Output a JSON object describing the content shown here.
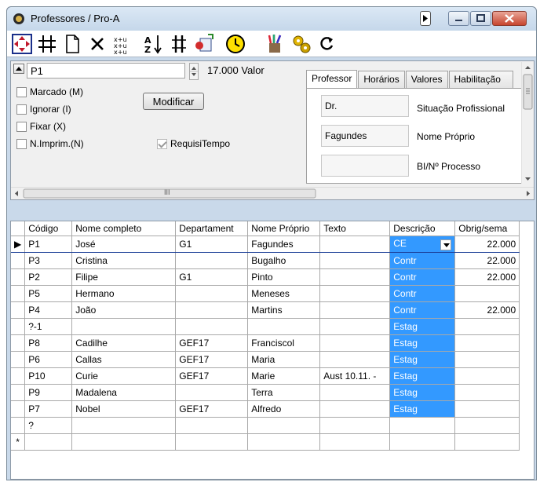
{
  "window": {
    "title": "Professores / Pro-A"
  },
  "toolbar": {
    "tools": [
      {
        "name": "navigate-icon"
      },
      {
        "name": "grid-icon"
      },
      {
        "name": "new-document-icon"
      },
      {
        "name": "delete-icon"
      },
      {
        "name": "sort-fields-icon"
      },
      {
        "name": "sort-az-icon"
      },
      {
        "name": "columns-icon"
      },
      {
        "name": "export-icon"
      },
      {
        "name": "clock-icon"
      },
      {
        "name": "paint-icon"
      },
      {
        "name": "settings-icon"
      },
      {
        "name": "refresh-icon"
      }
    ]
  },
  "form": {
    "code_value": "P1",
    "valor_label": "17.000 Valor",
    "checkboxes": [
      {
        "label": "Marcado (M)",
        "checked": false
      },
      {
        "label": "Ignorar (I)",
        "checked": false
      },
      {
        "label": "Fixar (X)",
        "checked": false
      },
      {
        "label": "N.Imprim.(N)",
        "checked": false
      }
    ],
    "requisitempo": {
      "label": "RequisiTempo",
      "checked": true
    },
    "modify_button": "Modificar",
    "tabs": [
      "Professor",
      "Horários",
      "Valores",
      "Habilitação"
    ],
    "fields": [
      {
        "value": "Dr.",
        "label": "Situação Profissional"
      },
      {
        "value": "Fagundes",
        "label": "Nome Próprio"
      },
      {
        "value": "",
        "label": "BI/Nº Processo"
      }
    ],
    "hscroll_grip": "III"
  },
  "grid": {
    "columns": [
      "Código",
      "Nome completo",
      "Departament",
      "Nome Próprio",
      "Texto",
      "Descrição",
      "Obrig/sema"
    ],
    "rows": [
      {
        "marker": "▶",
        "code": "P1",
        "name": "José",
        "dept": "G1",
        "first": "Fagundes",
        "text": "",
        "desc": "CE",
        "obrig": "22.000"
      },
      {
        "marker": "",
        "code": "P3",
        "name": "Cristina",
        "dept": "",
        "first": "Bugalho",
        "text": "",
        "desc": "Contr",
        "obrig": "22.000"
      },
      {
        "marker": "",
        "code": "P2",
        "name": "Filipe",
        "dept": "G1",
        "first": "Pinto",
        "text": "",
        "desc": "Contr",
        "obrig": "22.000"
      },
      {
        "marker": "",
        "code": "P5",
        "name": "Hermano",
        "dept": "",
        "first": "Meneses",
        "text": "",
        "desc": "Contr",
        "obrig": ""
      },
      {
        "marker": "",
        "code": "P4",
        "name": "João",
        "dept": "",
        "first": "Martins",
        "text": "",
        "desc": "Contr",
        "obrig": "22.000"
      },
      {
        "marker": "",
        "code": "?-1",
        "name": "",
        "dept": "",
        "first": "",
        "text": "",
        "desc": "Estag",
        "obrig": ""
      },
      {
        "marker": "",
        "code": "P8",
        "name": "Cadilhe",
        "dept": "GEF17",
        "first": "Franciscol",
        "text": "",
        "desc": "Estag",
        "obrig": ""
      },
      {
        "marker": "",
        "code": "P6",
        "name": "Callas",
        "dept": "GEF17",
        "first": "Maria",
        "text": "",
        "desc": "Estag",
        "obrig": ""
      },
      {
        "marker": "",
        "code": "P10",
        "name": "Curie",
        "dept": "GEF17",
        "first": "Marie",
        "text": "Aust 10.11. -",
        "desc": "Estag",
        "obrig": ""
      },
      {
        "marker": "",
        "code": "P9",
        "name": "Madalena",
        "dept": "",
        "first": "Terra",
        "text": "",
        "desc": "Estag",
        "obrig": ""
      },
      {
        "marker": "",
        "code": "P7",
        "name": "Nobel",
        "dept": "GEF17",
        "first": "Alfredo",
        "text": "",
        "desc": "Estag",
        "obrig": ""
      },
      {
        "marker": "",
        "code": "?",
        "name": "",
        "dept": "",
        "first": "",
        "text": "",
        "desc": "",
        "obrig": ""
      },
      {
        "marker": "*",
        "code": "",
        "name": "",
        "dept": "",
        "first": "",
        "text": "",
        "desc": "",
        "obrig": ""
      }
    ]
  },
  "colors": {
    "selection": "#3399ff",
    "titlebar": "#c9d9ea"
  }
}
